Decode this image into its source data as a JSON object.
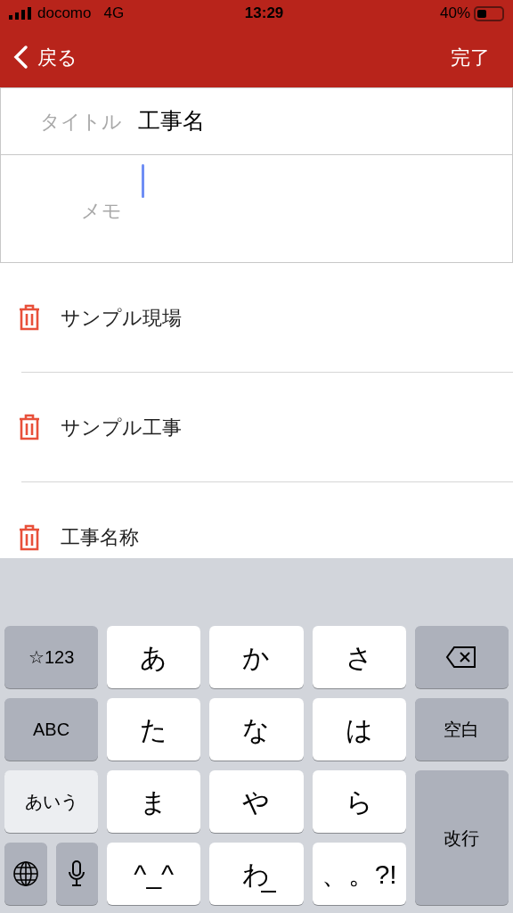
{
  "status_bar": {
    "carrier": "docomo",
    "network": "4G",
    "time": "13:29",
    "battery": "40%"
  },
  "nav": {
    "back": "戻る",
    "done": "完了"
  },
  "form": {
    "title_label": "タイトル",
    "title_value": "工事名",
    "memo_label": "メモ",
    "memo_focused": true
  },
  "list": [
    {
      "name": "サンプル現場"
    },
    {
      "name": "サンプル工事"
    },
    {
      "name": "工事名称"
    }
  ],
  "keyboard": {
    "keys": [
      {
        "kind": "mode",
        "label": "☆123"
      },
      {
        "kind": "char",
        "label": "あ"
      },
      {
        "kind": "char",
        "label": "か"
      },
      {
        "kind": "char",
        "label": "さ"
      },
      {
        "kind": "delete"
      },
      {
        "kind": "mode",
        "label": "ABC"
      },
      {
        "kind": "char",
        "label": "た"
      },
      {
        "kind": "char",
        "label": "な"
      },
      {
        "kind": "char",
        "label": "は"
      },
      {
        "kind": "mode",
        "label": "空白"
      },
      {
        "kind": "mode",
        "label": "あいう",
        "selected": true
      },
      {
        "kind": "char",
        "label": "ま"
      },
      {
        "kind": "char",
        "label": "や"
      },
      {
        "kind": "char",
        "label": "ら"
      },
      {
        "kind": "return",
        "label": "改行"
      },
      {
        "kind": "globe"
      },
      {
        "kind": "mic"
      },
      {
        "kind": "char",
        "label": "^_^"
      },
      {
        "kind": "small",
        "label": "わ"
      },
      {
        "kind": "char",
        "label": "、。?!"
      }
    ]
  }
}
